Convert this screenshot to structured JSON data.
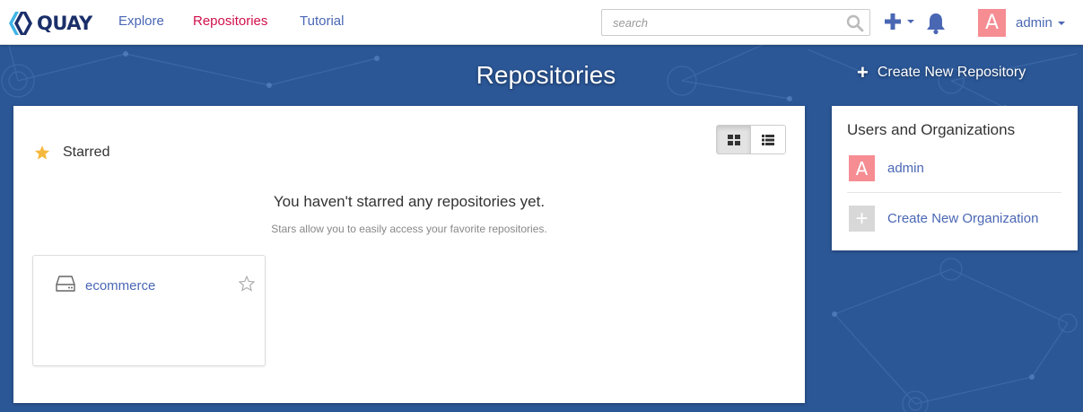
{
  "brand": {
    "name": "QUAY"
  },
  "nav": {
    "links": [
      "Explore",
      "Repositories",
      "Tutorial"
    ],
    "active": "Repositories"
  },
  "search": {
    "placeholder": "search",
    "value": ""
  },
  "user": {
    "name": "admin",
    "initial": "A",
    "avatar_color": "#f58d93"
  },
  "page": {
    "title": "Repositories",
    "create_repo_label": "Create New Repository"
  },
  "starred": {
    "heading": "Starred",
    "empty_title": "You haven't starred any repositories yet.",
    "empty_subtitle": "Stars allow you to easily access your favorite repositories."
  },
  "repos": [
    {
      "name": "ecommerce"
    }
  ],
  "side_panel": {
    "title": "Users and Organizations",
    "user_label": "admin",
    "user_initial": "A",
    "create_org_label": "Create New Organization",
    "create_org_glyph": "+"
  },
  "icons": [
    "quay-logo-icon",
    "search-icon",
    "plus-icon",
    "bell-icon",
    "grid-view-icon",
    "list-view-icon",
    "star-icon",
    "repo-drive-icon",
    "star-outline-icon"
  ],
  "colors": {
    "link": "#4a67b4",
    "active_link": "#d0104c",
    "background": "#2b5797",
    "star": "#f6b93f",
    "brand": "#1a2f6a"
  }
}
